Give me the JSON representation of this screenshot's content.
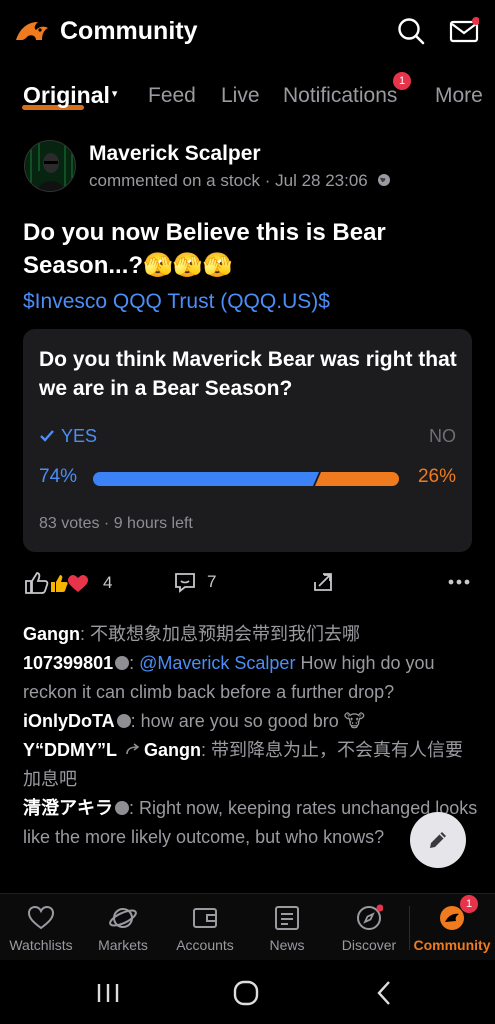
{
  "header": {
    "title": "Community",
    "accent_color": "#f07b1e"
  },
  "tabs": [
    {
      "label": "Original",
      "active": true,
      "caret": "▾"
    },
    {
      "label": "Feed"
    },
    {
      "label": "Live"
    },
    {
      "label": "Notifications",
      "badge": "1"
    },
    {
      "label": "More"
    }
  ],
  "post": {
    "author": "Maverick Scalper",
    "meta": "commented on a stock · Jul 28 23:06",
    "title": "Do you now Believe this is Bear Season...?🫣🫣🫣",
    "stock": "$Invesco QQQ Trust (QQQ.US)$",
    "poll": {
      "question": "Do you think Maverick Bear was right that we are in a Bear Season?",
      "yes_label": "YES",
      "no_label": "NO",
      "yes_pct": "74%",
      "no_pct": "26%",
      "yes_fraction": 0.74,
      "footer": "83 votes · 9 hours left"
    },
    "likes": "4",
    "comments_count": "7"
  },
  "comments": [
    {
      "name": "Gangn",
      "text": ": 不敢想象加息预期会带到我们去哪"
    },
    {
      "name": "107399801",
      "mention": "@Maverick Scalper",
      "text": " How high do you reckon it can climb back before a further drop?"
    },
    {
      "name": "iOnlyDoTA",
      "text": ": how are you so good bro 🐮"
    },
    {
      "name": "Y“DDMY”L",
      "reply_to": "Gangn",
      "text": ": 带到降息为止，不会真有人信要加息吧"
    },
    {
      "name": "清澄アキラ",
      "text": ": Right now, keeping rates unchanged looks like the more likely outcome, but who knows?"
    }
  ],
  "bottom_nav": [
    {
      "label": "Watchlists",
      "icon": "heart-icon"
    },
    {
      "label": "Markets",
      "icon": "planet-icon"
    },
    {
      "label": "Accounts",
      "icon": "wallet-icon"
    },
    {
      "label": "News",
      "icon": "news-icon"
    },
    {
      "label": "Discover",
      "icon": "compass-icon"
    },
    {
      "label": "Community",
      "icon": "community-icon",
      "active": true,
      "badge": "1"
    }
  ]
}
